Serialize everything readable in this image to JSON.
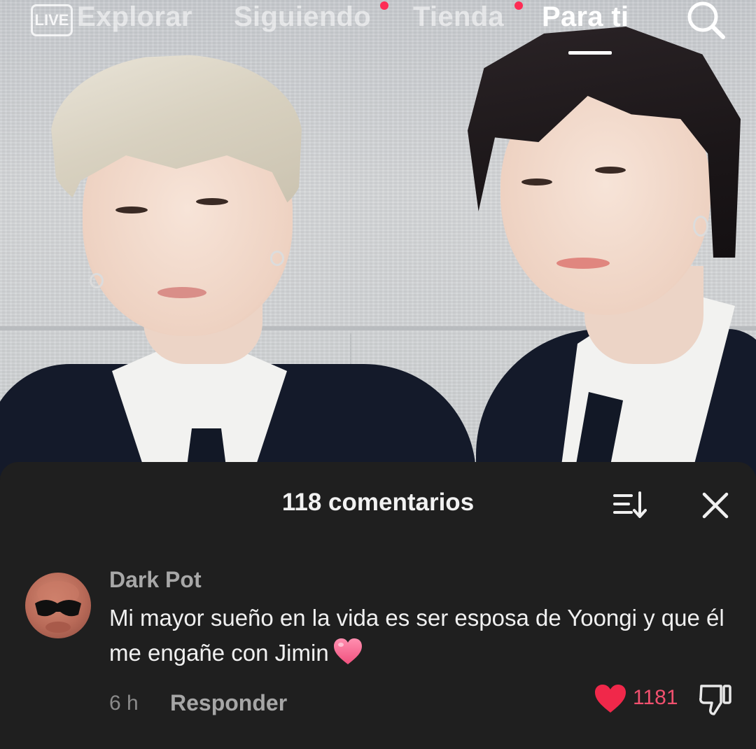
{
  "topnav": {
    "live_label": "LIVE",
    "tabs": [
      {
        "label": "Explorar",
        "active": false
      },
      {
        "label": "Siguiendo",
        "active": false
      },
      {
        "label": "Tienda",
        "active": false
      },
      {
        "label": "Para ti",
        "active": true
      }
    ],
    "search_icon": "search-icon"
  },
  "comments": {
    "title": "118 comentarios",
    "sort_icon": "sort-icon",
    "close_icon": "close-icon",
    "items": [
      {
        "user": "Dark Pot",
        "text": "Mi mayor sueño en la vida es ser esposa de Yoongi y que él me engañe con Jimin",
        "emoji": "heart-emoji",
        "time": "6 h",
        "reply_label": "Responder",
        "like_count": "1181"
      }
    ]
  },
  "colors": {
    "accent": "#fe2c55",
    "like": "#f0506e",
    "sheet_bg": "#1f1f1f"
  }
}
